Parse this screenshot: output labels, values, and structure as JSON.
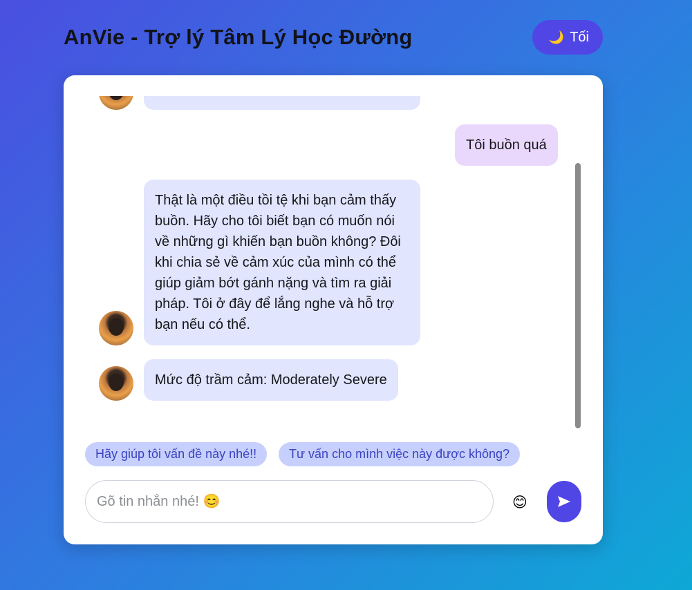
{
  "header": {
    "title": "AnVie - Trợ lý Tâm Lý Học Đường",
    "theme_toggle": {
      "icon": "moon-icon",
      "label": "Tối"
    }
  },
  "chat": {
    "messages": [
      {
        "sender": "bot",
        "text": ""
      },
      {
        "sender": "user",
        "text": "Tôi buồn quá"
      },
      {
        "sender": "bot",
        "text": "Thật là một điều tồi tệ khi bạn cảm thấy buồn. Hãy cho tôi biết bạn có muốn nói về những gì khiến bạn buồn không? Đôi khi chia sẻ về cảm xúc của mình có thể giúp giảm bớt gánh nặng và tìm ra giải pháp. Tôi ở đây để lắng nghe và hỗ trợ bạn nếu có thể."
      },
      {
        "sender": "bot",
        "text": "Mức độ trầm cảm: Moderately Severe"
      }
    ]
  },
  "suggestions": [
    "Hãy giúp tôi vấn đề này nhé!!",
    "Tư vấn cho mình việc này được không?"
  ],
  "composer": {
    "placeholder": "Gõ tin nhắn nhé! 😊",
    "emoji_icon": "😊",
    "send_icon": "send-icon"
  },
  "colors": {
    "accent": "#5046e6",
    "bot_bubble": "#e1e5fd",
    "user_bubble": "#ead8fc",
    "suggestion_bg": "#c7cffc",
    "suggestion_text": "#3a43c0"
  }
}
